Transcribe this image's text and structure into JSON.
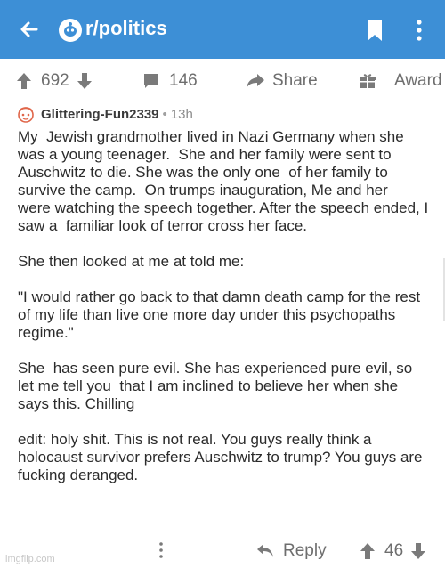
{
  "header": {
    "subreddit": "r/politics",
    "back_icon": "arrow-left-icon",
    "subreddit_icon": "subreddit-avatar-icon",
    "bookmark_icon": "bookmark-icon",
    "more_icon": "more-vertical-icon",
    "bg_color": "#3d8fd6"
  },
  "actions": {
    "upvotes": "692",
    "comments": "146",
    "share_label": "Share",
    "award_label": "Award"
  },
  "comment": {
    "author": "Glittering-Fun2339",
    "separator": "•",
    "time": "13h",
    "paragraphs": [
      "My  Jewish grandmother lived in Nazi Germany when she was a young teenager.  She and her family were sent to Auschwitz to die. She was the only one  of her family to survive the camp.  On trumps inauguration, Me and her  were watching the speech together. After the speech ended, I saw a  familiar look of terror cross her face.",
      "She then looked at me at told me:",
      "\"I would rather go back to that damn death camp for the rest of my life than live one more day under this psychopaths regime.\"",
      "She  has seen pure evil. She has experienced pure evil, so let me tell you  that I am inclined to believe her when she says this. Chilling",
      "edit: holy shit. This is not real. You guys really think a holocaust survivor prefers Auschwitz to trump? You guys are fucking deranged."
    ]
  },
  "footer": {
    "reply_label": "Reply",
    "score": "46"
  },
  "watermark": "imgflip.com"
}
